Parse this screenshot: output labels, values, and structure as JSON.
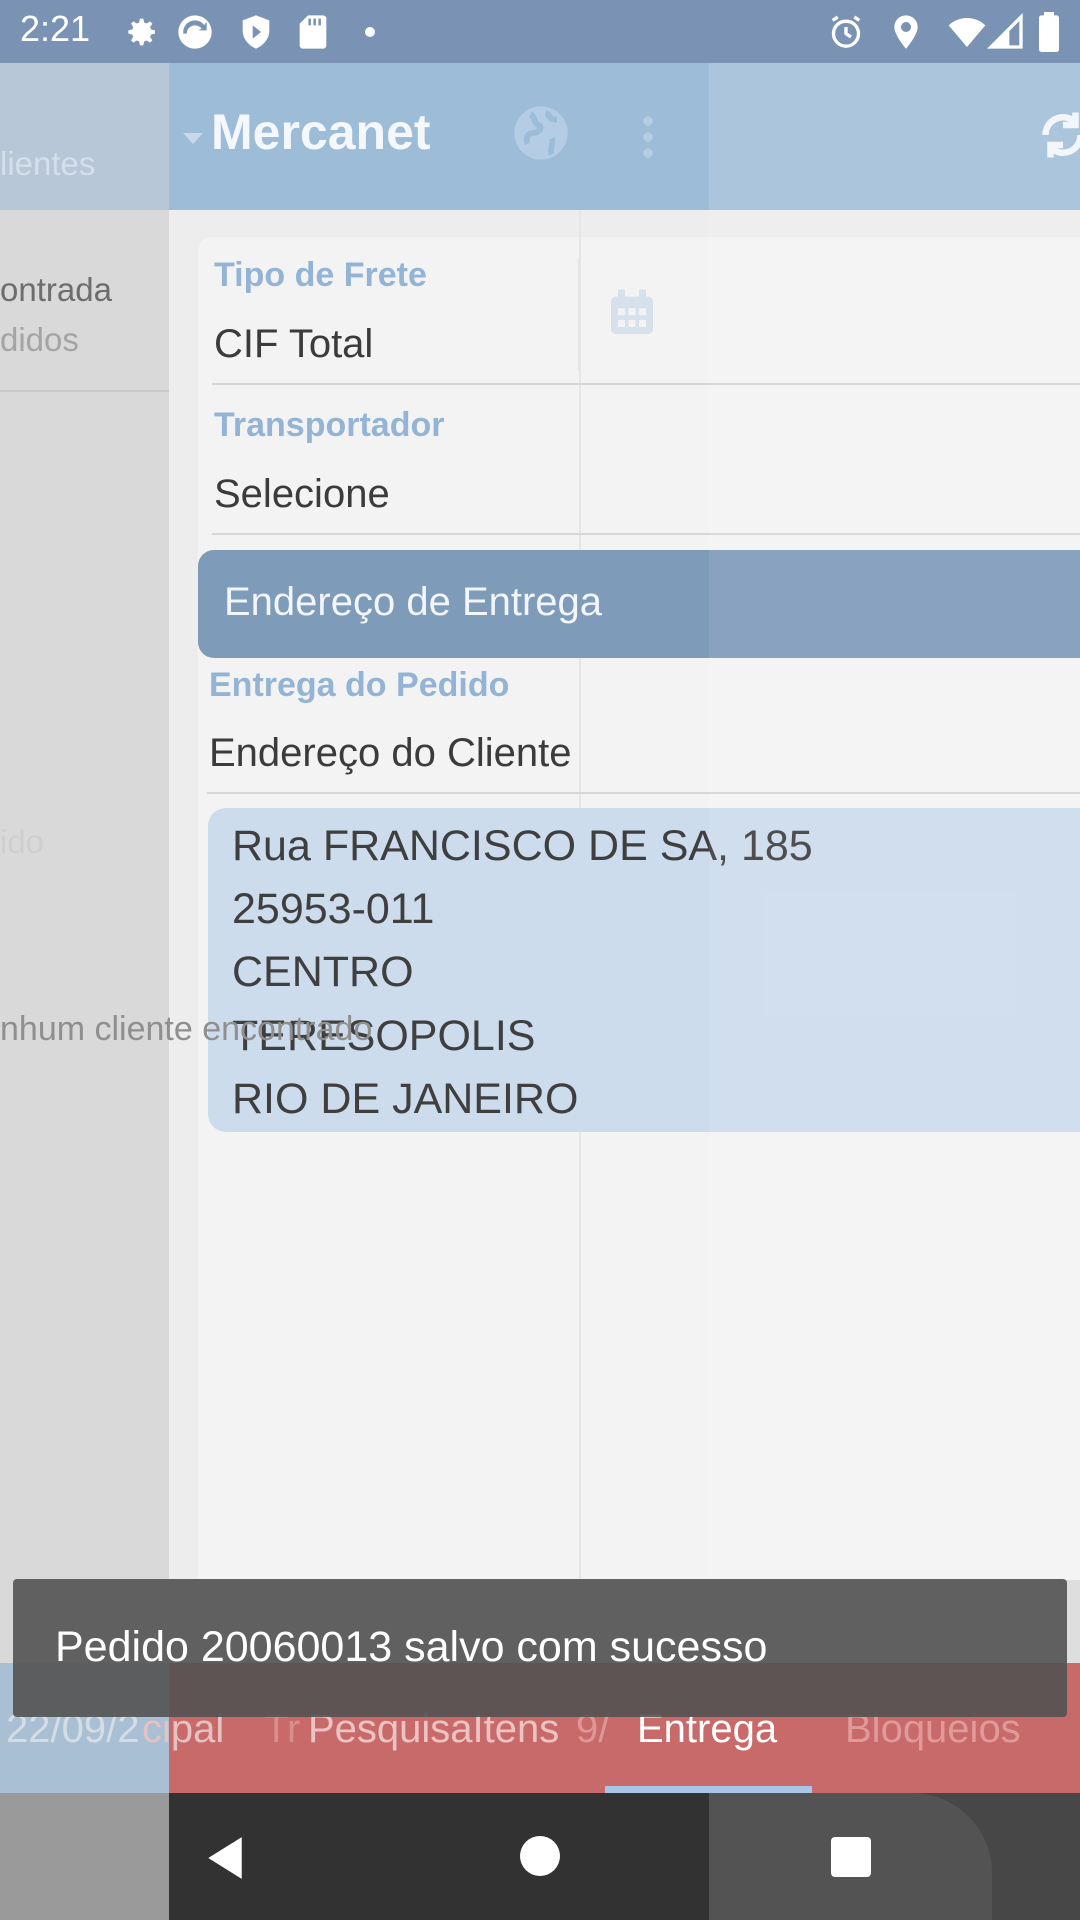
{
  "status_bar": {
    "time": "2:21",
    "left_icons": [
      "settings-icon",
      "sync-app-icon",
      "shield-icon",
      "sd-card-icon",
      "dot-icon"
    ],
    "right_icons": [
      "alarm-icon",
      "location-icon",
      "wifi-icon",
      "signal-icon",
      "battery-icon"
    ]
  },
  "background_drawer": {
    "header_text": "lientes",
    "line1": "ontrada",
    "line2": "didos",
    "faded_text": "ido",
    "empty_text": "nhum cliente encontrado"
  },
  "toolbar": {
    "title": "Mercanet",
    "icons": [
      "dropdown-arrow-icon",
      "globe-icon",
      "more-vert-icon",
      "refresh-icon"
    ]
  },
  "form": {
    "freight_label": "Tipo de Frete",
    "freight_value": "CIF Total",
    "carrier_label": "Transportador",
    "carrier_value": "Selecione",
    "delivery_section": "Endereço de Entrega",
    "delivery_label": "Entrega do Pedido",
    "delivery_value": "Endereço do Cliente",
    "address": {
      "street": "Rua FRANCISCO DE SA, 185",
      "zip": "25953-011",
      "district": "CENTRO",
      "city": "TERESOPOLIS",
      "state": "RIO DE JANEIRO"
    }
  },
  "tabs": {
    "ghost_left": "22/09/2",
    "items": [
      "cipal",
      "PesquisaItens",
      "Entrega",
      "Bloqueios"
    ],
    "ghost_mid_1": "Tr",
    "ghost_mid_2": "9/",
    "active": "Entrega"
  },
  "toast": {
    "message": "Pedido 20060013 salvo com sucesso"
  },
  "colors": {
    "toolbar": "#9dbcd8",
    "section_header": "#7f9bba",
    "tabbar": "#c86a6a",
    "label": "#93b4d4"
  }
}
